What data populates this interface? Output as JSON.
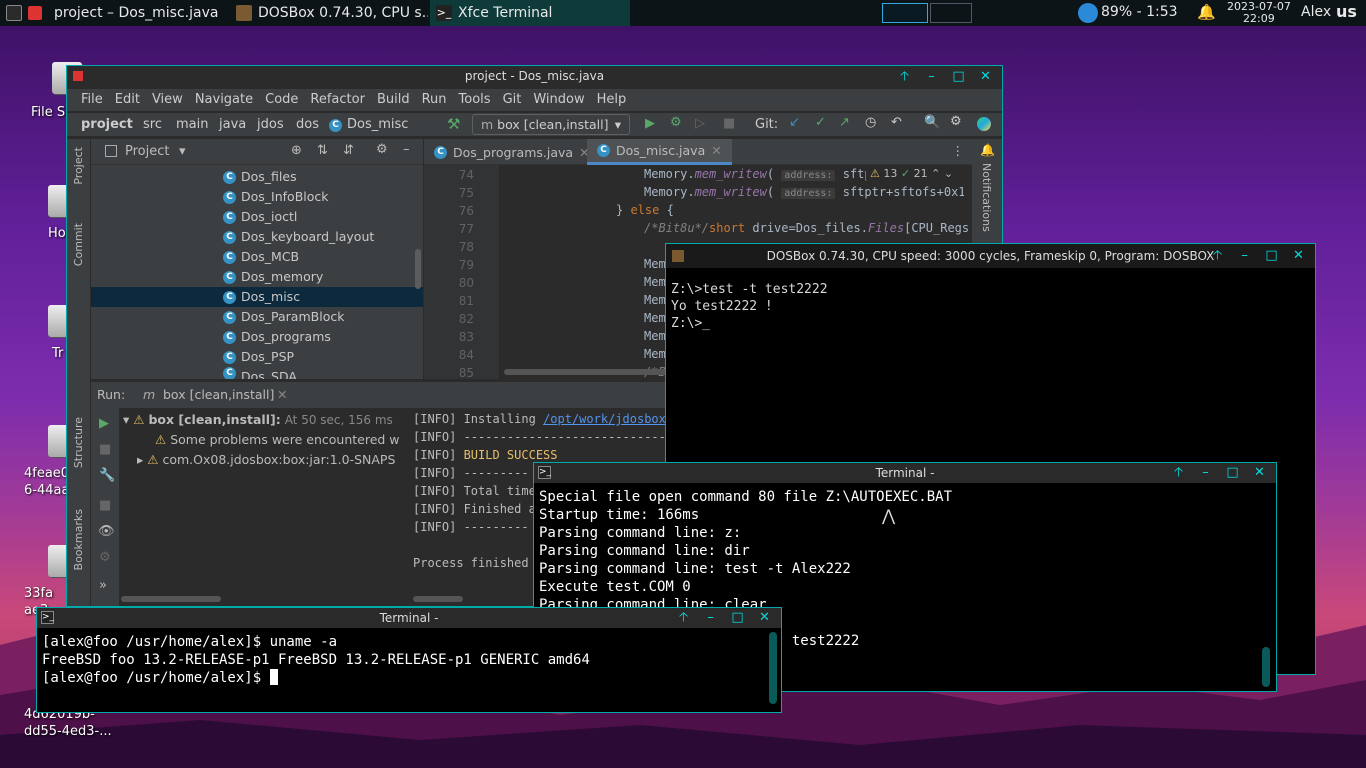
{
  "panel": {
    "tasks": [
      {
        "label": "project – Dos_misc.java",
        "active": false
      },
      {
        "label": "DOSBox 0.74.30, CPU s...",
        "active": false
      },
      {
        "label": "Xfce Terminal",
        "active": true,
        "badge": "2"
      }
    ],
    "battery": "89% - 1:53",
    "date": "2023-07-07",
    "time": "22:09",
    "user": "Alex",
    "keyboard": "us"
  },
  "desktop": {
    "icons": [
      {
        "label": "File S"
      },
      {
        "label": "Ho"
      },
      {
        "label": "Tr"
      },
      {
        "label": "4feae0\n6-44aa"
      },
      {
        "label": "33fa\nae3"
      },
      {
        "label": "4d62019b-\ndd55-4ed3-..."
      }
    ]
  },
  "ide": {
    "title": "project - Dos_misc.java",
    "menu": [
      "File",
      "Edit",
      "View",
      "Navigate",
      "Code",
      "Refactor",
      "Build",
      "Run",
      "Tools",
      "Git",
      "Window",
      "Help"
    ],
    "breadcrumb": [
      "project",
      "src",
      "main",
      "java",
      "jdos",
      "dos",
      "Dos_misc"
    ],
    "run_config": "box [clean,install]",
    "git_label": "Git:",
    "left_tabs": [
      "Project",
      "Commit",
      "Structure",
      "Bookmarks"
    ],
    "right_tab": "Notifications",
    "project_header": "Project",
    "tree": [
      "Dos_files",
      "Dos_InfoBlock",
      "Dos_ioctl",
      "Dos_keyboard_layout",
      "Dos_MCB",
      "Dos_memory",
      "Dos_misc",
      "Dos_ParamBlock",
      "Dos_programs",
      "Dos_PSP",
      "Dos_SDA"
    ],
    "selected_tree_item": "Dos_misc",
    "tabs": [
      "Dos_programs.java",
      "Dos_misc.java"
    ],
    "warnings": "13",
    "weak_warnings": "21",
    "line_numbers": [
      "74",
      "75",
      "76",
      "77",
      "78",
      "79",
      "80",
      "81",
      "82",
      "83",
      "84",
      "85"
    ],
    "code": {
      "l74_a": "Memory.",
      "l74_b": "mem_writew",
      "l74_c": "(",
      "l74_hint": "address:",
      "l74_d": "sftp",
      "l75_a": "Memory.",
      "l75_b": "mem_writew",
      "l75_c": "(",
      "l75_hint": "address:",
      "l75_d": "sftptr+sftofs+0x15",
      "l76_a": "} ",
      "l76_b": "else",
      "l76_c": " {",
      "l77_a": "/*Bit8u*/",
      "l77_b": "short",
      "l77_c": " drive=Dos_files.",
      "l77_d": "Files",
      "l77_e": "[CPU_Regs.",
      "l77_f": "re",
      "mem": "Memo",
      "l85": "/*B"
    },
    "run": {
      "label": "Run:",
      "tab": "box [clean,install]",
      "root": "box [clean,install]:",
      "root_time": "At 50 sec, 156 ms",
      "problem": "Some problems were encountered w",
      "artifact": "com.Ox08.jdosbox:box:jar:1.0-SNAPS",
      "output": [
        {
          "tag": "[INFO]",
          "text": " Installing ",
          "link": "/opt/work/jdosbox-"
        },
        {
          "tag": "[INFO]",
          "text": " ------------------------------------------------",
          "link": ""
        },
        {
          "tag": "[INFO]",
          "text": " BUILD SUCCESS",
          "link": ""
        },
        {
          "tag": "[INFO]",
          "text": " ---------",
          "link": ""
        },
        {
          "tag": "[INFO]",
          "text": " Total time",
          "link": ""
        },
        {
          "tag": "[INFO]",
          "text": " Finished a",
          "link": ""
        },
        {
          "tag": "[INFO]",
          "text": " ---------",
          "link": ""
        }
      ],
      "finished": "Process finished "
    }
  },
  "dosbox": {
    "title": "DOSBox 0.74.30, CPU speed: 3000 cycles, Frameskip 0, Program: DOSBOX",
    "lines": [
      "Z:\\>test -t test2222",
      "Yo test2222 !",
      "Z:\\>_"
    ]
  },
  "terminal_right": {
    "title": "Terminal -",
    "lines": [
      "Special file open command 80 file Z:\\AUTOEXEC.BAT",
      "Startup time: 166ms",
      "Parsing command line: z:",
      "Parsing command line: dir",
      "Parsing command line: test -t Alex222",
      "Execute test.COM 0",
      "Parsing command line: clear",
      "",
      "Parsing command line: test -t test2222"
    ]
  },
  "terminal_left": {
    "title": "Terminal -",
    "lines": [
      "[alex@foo /usr/home/alex]$ uname -a",
      "FreeBSD foo 13.2-RELEASE-p1 FreeBSD 13.2-RELEASE-p1 GENERIC amd64",
      "[alex@foo /usr/home/alex]$ "
    ]
  }
}
